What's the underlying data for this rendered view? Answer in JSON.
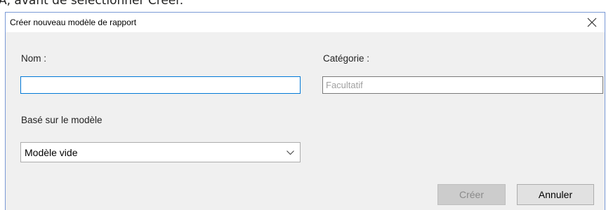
{
  "background": {
    "partial_text": "A, avant de sélectionner Créer."
  },
  "dialog": {
    "title": "Créer nouveau modèle de rapport",
    "close_glyph": "×"
  },
  "form": {
    "name_label": "Nom :",
    "name_value": "",
    "category_label": "Catégorie :",
    "category_placeholder": "Facultatif",
    "based_on_label": "Basé sur le modèle",
    "based_on_selected": "Modèle vide"
  },
  "buttons": {
    "create_label": "Créer",
    "create_enabled": false,
    "cancel_label": "Annuler"
  },
  "colors": {
    "focus_border": "#0078d7",
    "dialog_bg": "#f0f0f0",
    "disabled_button_bg": "#cccccc"
  },
  "icons": {
    "close": "close-icon",
    "dropdown": "chevron-down-icon"
  }
}
